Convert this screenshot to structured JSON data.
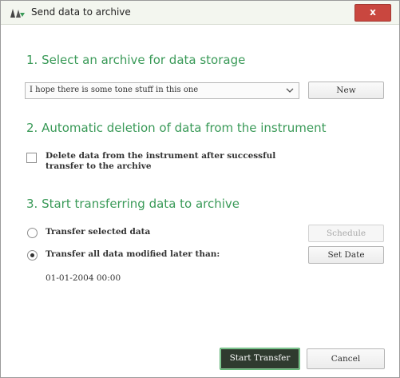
{
  "window": {
    "title": "Send data to archive",
    "close_label": "x"
  },
  "section1": {
    "heading": "1. Select an archive for data storage",
    "archive_selected": "I hope there is some tone stuff in this one",
    "new_button": "New"
  },
  "section2": {
    "heading": "2. Automatic deletion of data from the instrument",
    "delete_checkbox_line1": "Delete data from the instrument after successful",
    "delete_checkbox_line2": "transfer to the archive",
    "delete_checked": false
  },
  "section3": {
    "heading": "3. Start transferring data to archive",
    "option_selected": "Transfer selected data",
    "option_all": "Transfer all data modified later than:",
    "selected_option": "all",
    "schedule_button": "Schedule",
    "set_date_button": "Set Date",
    "date_value": "01-01-2004 00:00"
  },
  "footer": {
    "start_transfer_button": "Start Transfer",
    "cancel_button": "Cancel"
  },
  "colors": {
    "heading_green": "#3a9a58",
    "close_red": "#c9473f",
    "primary_dark": "#2f3a2f"
  }
}
